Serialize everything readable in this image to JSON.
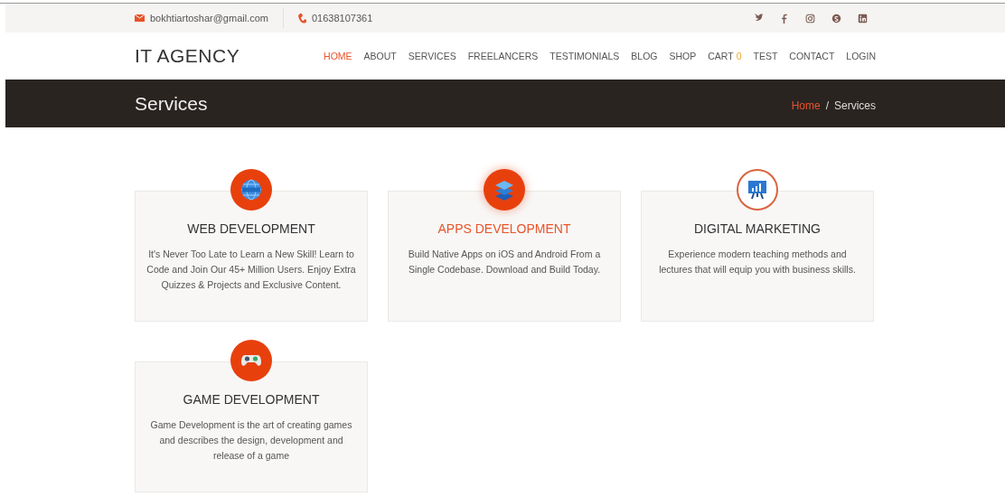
{
  "topbar": {
    "email": "bokhtiartoshar@gmail.com",
    "phone": "01638107361",
    "social": [
      {
        "kind": "twitter"
      },
      {
        "kind": "facebook"
      },
      {
        "kind": "instagram"
      },
      {
        "kind": "skype"
      },
      {
        "kind": "linkedin"
      }
    ]
  },
  "header": {
    "logo": "IT AGENCY",
    "nav": [
      {
        "label": "HOME",
        "selected": true
      },
      {
        "label": "ABOUT",
        "selected": false
      },
      {
        "label": "SERVICES",
        "selected": false
      },
      {
        "label": "FREELANCERS",
        "selected": false
      },
      {
        "label": "TESTIMONIALS",
        "selected": false
      },
      {
        "label": "BLOG",
        "selected": false
      },
      {
        "label": "SHOP",
        "selected": false
      },
      {
        "label": "CART",
        "badge": "0",
        "selected": false
      },
      {
        "label": "TEST",
        "selected": false
      },
      {
        "label": "CONTACT",
        "selected": false
      },
      {
        "label": "LOGIN",
        "selected": false
      }
    ]
  },
  "banner": {
    "title": "Services",
    "breadcrumb": {
      "home": "Home",
      "separator": "/",
      "current": "Services"
    }
  },
  "services": [
    {
      "kind": "globe",
      "title": "WEB DEVELOPMENT",
      "description": "It's Never Too Late to Learn a New Skill! Learn to Code and Join Our 45+ Million Users. Enjoy Extra Quizzes & Projects and Exclusive Content.",
      "highlighted": false,
      "outlined": false
    },
    {
      "kind": "layers",
      "title": "APPS DEVELOPMENT",
      "description": "Build Native Apps on iOS and Android From a Single Codebase. Download and Build Today.",
      "highlighted": true,
      "outlined": false
    },
    {
      "kind": "board",
      "title": "DIGITAL MARKETING",
      "description": "Experience modern teaching methods and lectures that will equip you with business skills.",
      "highlighted": false,
      "outlined": true
    },
    {
      "kind": "gamepad",
      "title": "GAME DEVELOPMENT",
      "description": "Game Development is the art of creating games and describes the design, development and release of a game",
      "highlighted": false,
      "outlined": false
    }
  ]
}
